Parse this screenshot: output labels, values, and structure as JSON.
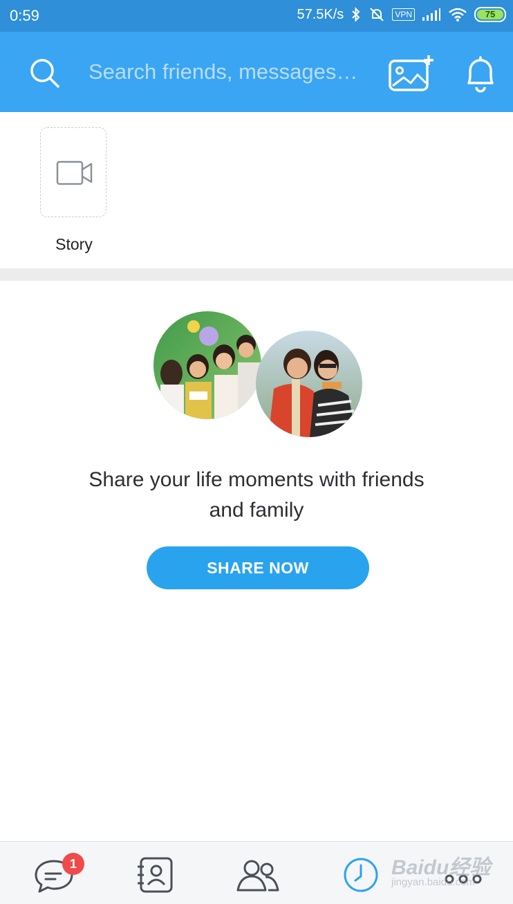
{
  "status_bar": {
    "time": "0:59",
    "speed": "57.5K/s",
    "vpn": "VPN",
    "battery": "75"
  },
  "header": {
    "search_placeholder": "Search friends, messages…",
    "icons": [
      "search-icon",
      "add-photo-icon",
      "bell-icon"
    ],
    "color": "#3aa5f2"
  },
  "story": {
    "label": "Story",
    "icon": "video-camera-icon"
  },
  "promo": {
    "line1": "Share your life moments with friends",
    "line2": "and family",
    "button_label": "SHARE NOW",
    "button_color": "#2aa3ee"
  },
  "bottom_nav": {
    "tabs": [
      {
        "name": "messages",
        "icon": "chat-bubble-icon",
        "badge": "1"
      },
      {
        "name": "contacts",
        "icon": "contact-card-icon"
      },
      {
        "name": "groups",
        "icon": "people-icon"
      },
      {
        "name": "timeline",
        "icon": "clock-icon",
        "active": true
      },
      {
        "name": "more",
        "icon": "more-icon"
      }
    ]
  },
  "watermark": {
    "main": "Baidu经验",
    "sub": "jingyan.baidu.com"
  }
}
